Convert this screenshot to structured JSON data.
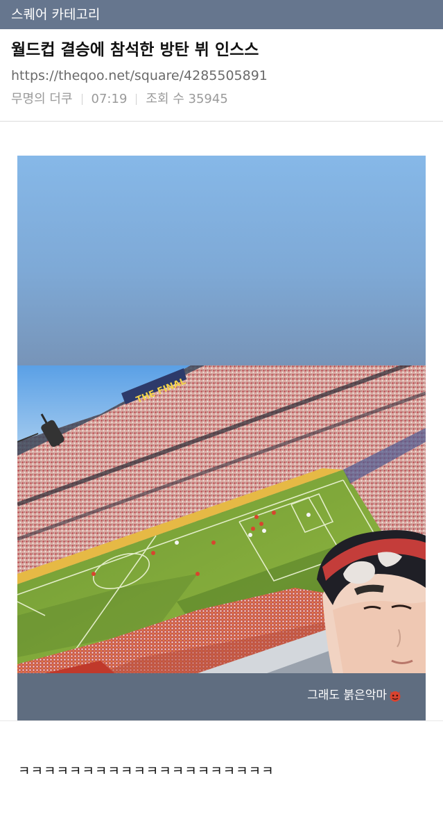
{
  "category": {
    "label": "스퀘어 카테고리"
  },
  "post": {
    "title": "월드컵 결승에 참석한 방탄 뷔 인스스",
    "url": "https://theqoo.net/square/4285505891",
    "author": "무명의 더쿠",
    "time": "07:19",
    "views": "조회 수 35945"
  },
  "story": {
    "banner_text": "THE FINAL",
    "caption": "그래도 붉은악마",
    "caption_icon": "red-devil-emoji"
  },
  "comment": {
    "text": "ㅋㅋㅋㅋㅋㅋㅋㅋㅋㅋㅋㅋㅋㅋㅋㅋㅋㅋㅋㅋ"
  }
}
